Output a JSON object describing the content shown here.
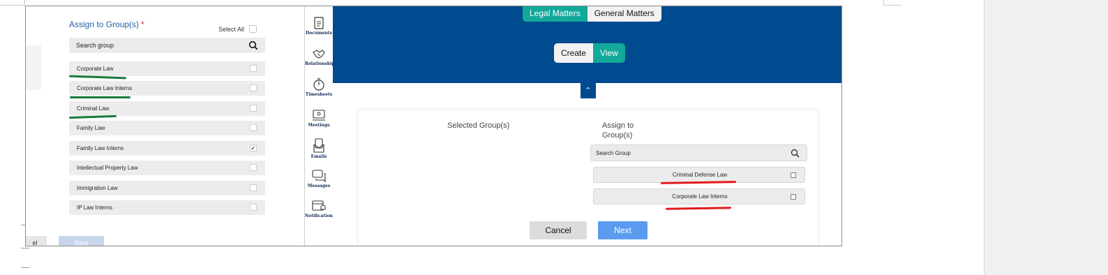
{
  "left_panel": {
    "title": "Assign to Group(s)",
    "required_mark": "*",
    "select_all_label": "Select All",
    "search_placeholder": "Search group",
    "groups": [
      {
        "label": "Corporate Law",
        "checked": false,
        "underlined": true
      },
      {
        "label": "Corporate Law Interns",
        "checked": false,
        "underlined": true
      },
      {
        "label": "Criminal Law",
        "checked": false,
        "underlined": true
      },
      {
        "label": "Family Law",
        "checked": false,
        "underlined": false
      },
      {
        "label": "Family Law Interns",
        "checked": true,
        "underlined": false
      },
      {
        "label": "Intellectual Property Law",
        "checked": false,
        "underlined": false
      },
      {
        "label": "Immigration Law",
        "checked": false,
        "underlined": false
      },
      {
        "label": "IP Law Interns",
        "checked": false,
        "underlined": false
      }
    ],
    "check_mark": "✓",
    "cancel_label": "el",
    "save_label": "Save"
  },
  "sidebar": {
    "items": [
      {
        "label": "Documents",
        "icon": "documents-icon"
      },
      {
        "label": "Relationships",
        "icon": "handshake-icon"
      },
      {
        "label": "Timesheets",
        "icon": "stopwatch-icon"
      },
      {
        "label": "Meetings",
        "icon": "meeting-icon"
      },
      {
        "label": "Emails",
        "icon": "email-icon"
      },
      {
        "label": "Messages",
        "icon": "chat-icon"
      },
      {
        "label": "Notifications",
        "icon": "calendar-bell-icon"
      }
    ]
  },
  "banner": {
    "matter_tabs": [
      "Legal Matters",
      "General Matters"
    ],
    "mode_tabs": [
      "Create",
      "View"
    ],
    "collapse_glyph": "⌃"
  },
  "card": {
    "selected_groups_label": "Selected Group(s)",
    "assign_to_label": "Assign to Group(s)",
    "search_placeholder": "Search Group",
    "groups": [
      {
        "label": "Criminal Defense Law"
      },
      {
        "label": "Corporate Law Interns"
      }
    ],
    "cancel_label": "Cancel",
    "next_label": "Next"
  },
  "colors": {
    "banner_blue": "#004a8f",
    "teal": "#12a99a",
    "title_blue": "#1f5fa8",
    "green_annotation": "#167a3c",
    "red_annotation": "#e4191c",
    "next_button": "#5a9bf0"
  }
}
